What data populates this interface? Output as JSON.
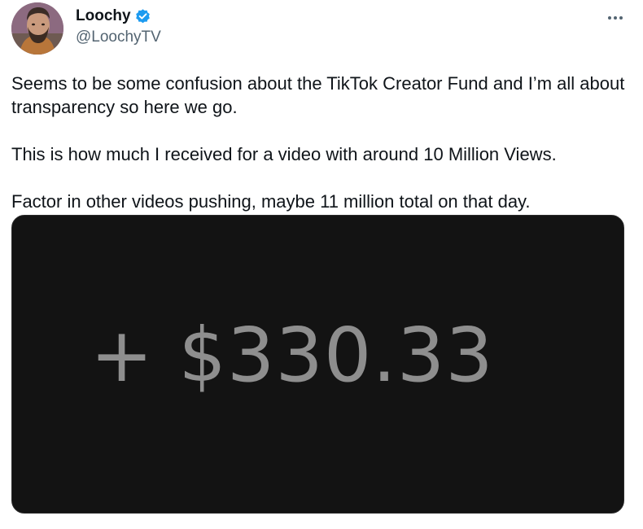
{
  "author": {
    "display_name": "Loochy",
    "handle": "@LoochyTV",
    "verified": true,
    "avatar_icon": "profile-avatar",
    "verified_icon": "verified-badge-icon",
    "verified_color": "#1d9bf0"
  },
  "menu": {
    "icon": "more-options-icon"
  },
  "tweet": {
    "paragraphs": [
      "Seems to be some confusion about the TikTok Creator Fund and I’m all about transparency so here we go.",
      "This is how much I received for a video with around 10 Million Views.",
      "Factor in other videos pushing, maybe 11 million total on that day."
    ]
  },
  "media": {
    "amount_text": "+ $330.33",
    "background_color": "#131313",
    "text_color": "#8e8e8e"
  }
}
